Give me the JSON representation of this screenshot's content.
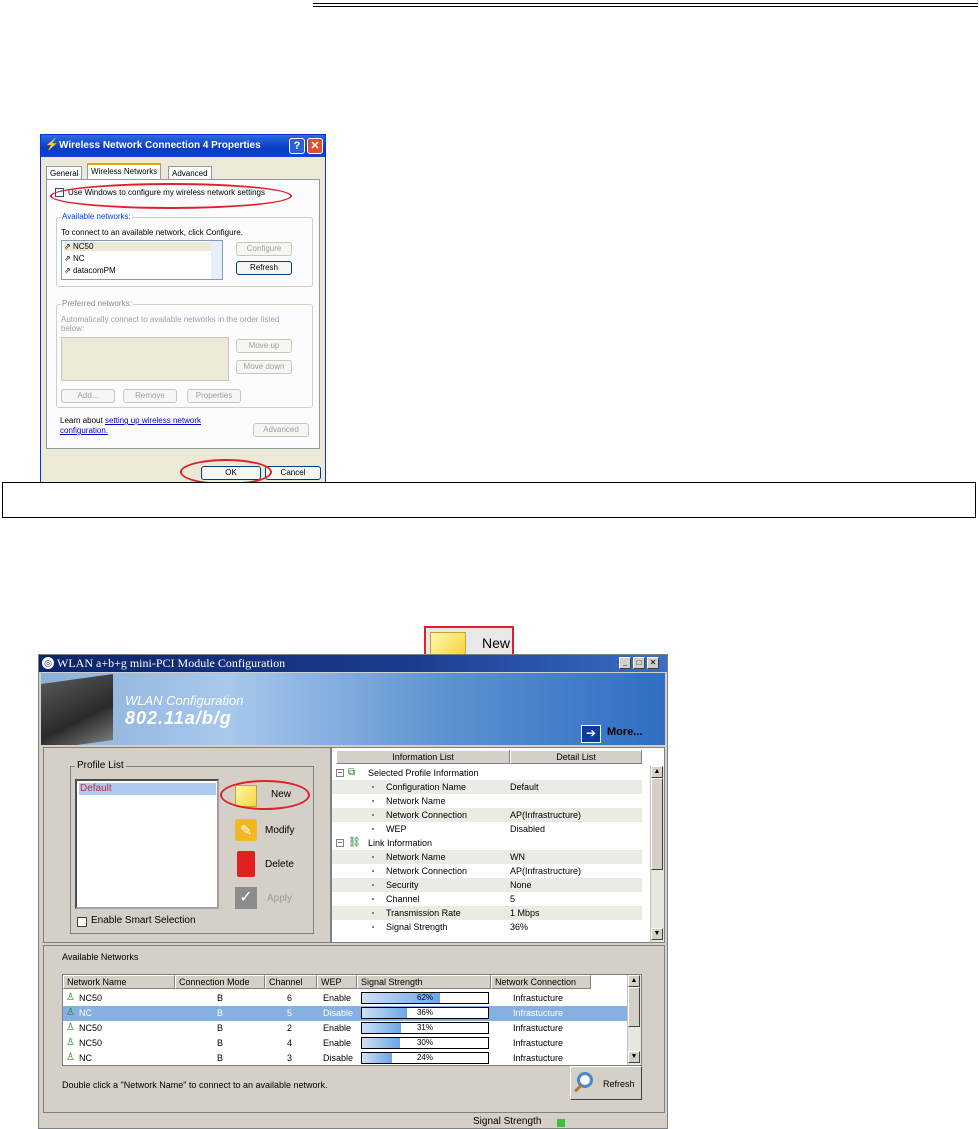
{
  "xp_dialog": {
    "title": "Wireless Network Connection 4 Properties",
    "help_button": "?",
    "close_button": "✕",
    "tabs": [
      "General",
      "Wireless Networks",
      "Advanced"
    ],
    "use_windows_label": "Use Windows to configure my wireless network settings",
    "available_networks": {
      "group_label": "Available networks:",
      "hint": "To connect to an available network, click Configure.",
      "items": [
        "NC50",
        "NC",
        "datacomPM"
      ],
      "configure_label": "Configure",
      "refresh_label": "Refresh"
    },
    "preferred_networks": {
      "group_label": "Preferred networks:",
      "hint_line1": "Automatically connect to available networks in the order listed",
      "hint_line2": "below:",
      "move_up_label": "Move up",
      "move_down_label": "Move down",
      "add_label": "Add...",
      "remove_label": "Remove",
      "properties_label": "Properties"
    },
    "learn_text": "Learn about",
    "learn_link_line1": "setting up wireless network",
    "learn_link_line2": "configuration.",
    "advanced_label": "Advanced",
    "ok_label": "OK",
    "cancel_label": "Cancel"
  },
  "new_callout": {
    "label": "New"
  },
  "app": {
    "title": "WLAN a+b+g mini-PCI Module Configuration",
    "banner_line1": "WLAN Configuration",
    "banner_line2": "802.11a/b/g",
    "more_label": "More...",
    "profile_list": {
      "label": "Profile List",
      "items": [
        "Default"
      ],
      "new_label": "New",
      "modify_label": "Modify",
      "delete_label": "Delete",
      "apply_label": "Apply",
      "smart_selection_label": "Enable Smart Selection"
    },
    "info": {
      "tab_info": "Information List",
      "tab_detail": "Detail List",
      "section1": "Selected Profile Information",
      "section1_rows": [
        {
          "k": "Configuration Name",
          "v": "Default"
        },
        {
          "k": "Network Name",
          "v": ""
        },
        {
          "k": "Network Connection",
          "v": "AP(Infrastructure)"
        },
        {
          "k": "WEP",
          "v": "Disabled"
        }
      ],
      "section2": "Link Information",
      "section2_rows": [
        {
          "k": "Network Name",
          "v": "WN"
        },
        {
          "k": "Network Connection",
          "v": "AP(Infrastructure)"
        },
        {
          "k": "Security",
          "v": "None"
        },
        {
          "k": "Channel",
          "v": "5"
        },
        {
          "k": "Transmission Rate",
          "v": "1 Mbps"
        },
        {
          "k": "Signal Strength",
          "v": "36%"
        }
      ]
    },
    "available": {
      "title": "Available Networks",
      "columns": [
        "Network Name",
        "Connection Mode",
        "Channel",
        "WEP",
        "Signal Strength",
        "Network Connection"
      ],
      "rows": [
        {
          "name": "NC50",
          "mode": "B",
          "channel": "6",
          "wep": "Enable",
          "signal": "62%",
          "signal_value": 0.62,
          "conn": "Infrastucture"
        },
        {
          "name": "NC",
          "mode": "B",
          "channel": "5",
          "wep": "Disable",
          "signal": "36%",
          "signal_value": 0.36,
          "conn": "Infrastucture"
        },
        {
          "name": "NC50",
          "mode": "B",
          "channel": "2",
          "wep": "Enable",
          "signal": "31%",
          "signal_value": 0.31,
          "conn": "Infrastucture"
        },
        {
          "name": "NC50",
          "mode": "B",
          "channel": "4",
          "wep": "Enable",
          "signal": "30%",
          "signal_value": 0.3,
          "conn": "Infrastucture"
        },
        {
          "name": "NC",
          "mode": "B",
          "channel": "3",
          "wep": "Disable",
          "signal": "24%",
          "signal_value": 0.24,
          "conn": "Infrastucture"
        }
      ],
      "selected_index": 1,
      "hint": "Double click a \"Network Name\" to connect to an available network.",
      "refresh_label": "Refresh"
    },
    "status_label": "Signal Strength"
  }
}
